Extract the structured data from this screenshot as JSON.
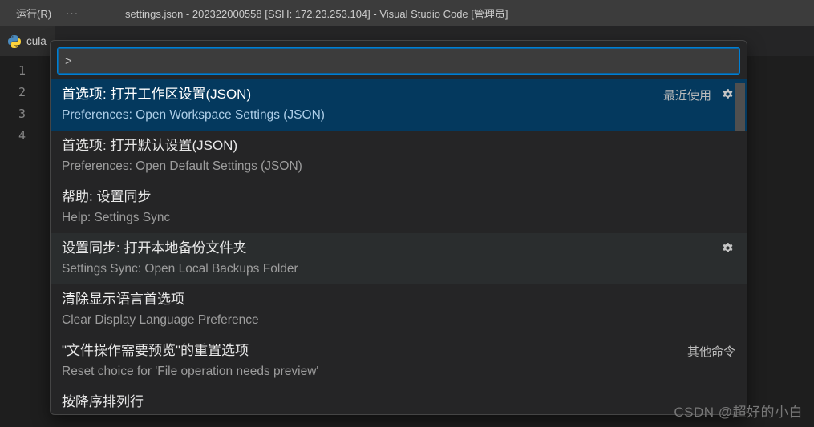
{
  "titlebar": {
    "menu_run": "运行(R)",
    "menu_more": "···",
    "title": "settings.json - 202322000558 [SSH: 172.23.253.104] - Visual Studio Code [管理员]"
  },
  "tab": {
    "label": "cula"
  },
  "gutter": {
    "lines": [
      "1",
      "2",
      "3",
      "4"
    ]
  },
  "palette": {
    "prefix": ">",
    "items": [
      {
        "title": "首选项: 打开工作区设置(JSON)",
        "subtitle": "Preferences: Open Workspace Settings (JSON)",
        "badge": "最近使用",
        "gear": true,
        "selected": true
      },
      {
        "title": "首选项: 打开默认设置(JSON)",
        "subtitle": "Preferences: Open Default Settings (JSON)"
      },
      {
        "title": "帮助: 设置同步",
        "subtitle": "Help: Settings Sync"
      },
      {
        "title": "设置同步: 打开本地备份文件夹",
        "subtitle": "Settings Sync: Open Local Backups Folder",
        "gear": true,
        "hover": true
      },
      {
        "title": "清除显示语言首选项",
        "subtitle": "Clear Display Language Preference"
      },
      {
        "title": "\"文件操作需要预览\"的重置选项",
        "subtitle": "Reset choice for 'File operation needs preview'",
        "badge": "其他命令"
      }
    ],
    "partial_item_title": "按降序排列行"
  },
  "watermark": "CSDN @超好的小白"
}
